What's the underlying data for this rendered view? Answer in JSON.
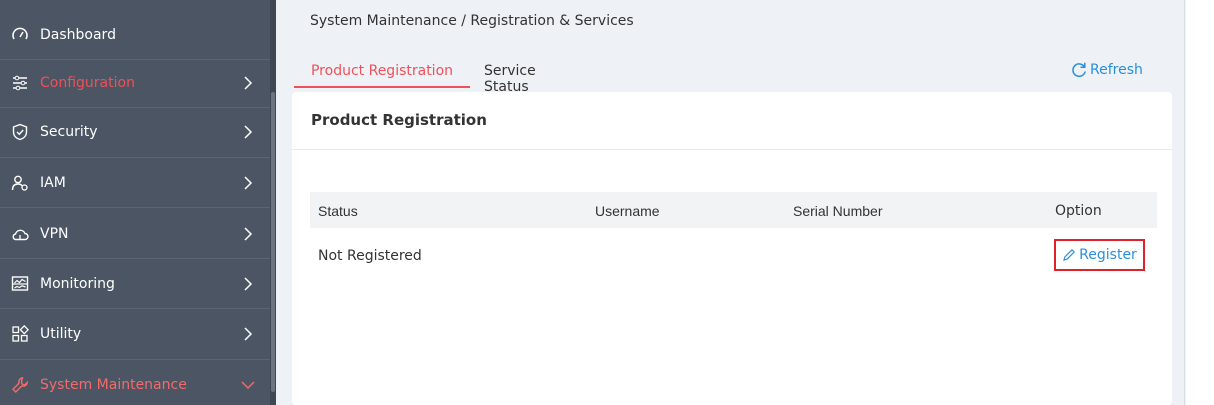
{
  "sidebar": {
    "items": [
      {
        "label": "Dashboard",
        "icon": "dashboard-gauge-icon",
        "has_chevron": false
      },
      {
        "label": "Configuration",
        "icon": "sliders-icon",
        "has_chevron": true
      },
      {
        "label": "Security",
        "icon": "shield-check-icon",
        "has_chevron": true
      },
      {
        "label": "IAM",
        "icon": "users-icon",
        "has_chevron": true
      },
      {
        "label": "VPN",
        "icon": "cloud-icon",
        "has_chevron": true
      },
      {
        "label": "Monitoring",
        "icon": "monitor-chart-icon",
        "has_chevron": true
      },
      {
        "label": "Utility",
        "icon": "grid-icon",
        "has_chevron": true
      },
      {
        "label": "System Maintenance",
        "icon": "wrench-icon",
        "has_chevron": true,
        "active": true
      }
    ]
  },
  "breadcrumb": "System Maintenance / Registration & Services",
  "tabs": [
    {
      "label": "Product Registration",
      "active": true
    },
    {
      "label": "Service Status",
      "active": false
    }
  ],
  "refresh_label": "Refresh",
  "card": {
    "title": "Product Registration",
    "table": {
      "columns": [
        "Status",
        "Username",
        "Serial Number",
        "Option"
      ],
      "rows": [
        {
          "status": "Not Registered",
          "username": "",
          "serial": "",
          "option": "Register"
        }
      ]
    }
  },
  "colors": {
    "sidebar_bg": "#4b5563",
    "accent_red": "#f0505a",
    "link_blue": "#2a8fdc",
    "highlight_box": "#e0202a"
  }
}
